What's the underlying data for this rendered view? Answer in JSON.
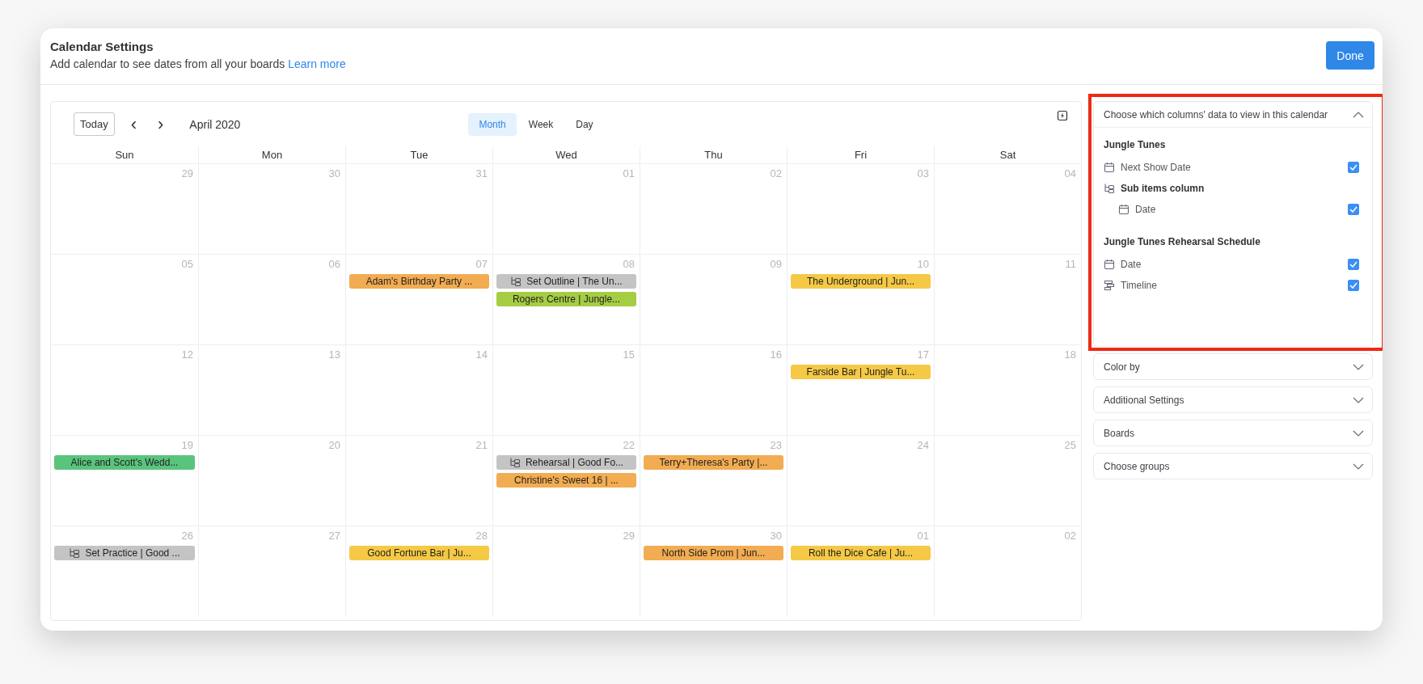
{
  "header": {
    "title": "Calendar Settings",
    "subtitle": "Add calendar to see dates from all your boards",
    "link": "Learn more",
    "done_button": "Done"
  },
  "calendar": {
    "today_button": "Today",
    "prev": "‹",
    "next": "›",
    "month_label": "April 2020",
    "views": [
      {
        "label": "Month",
        "selected": true
      },
      {
        "label": "Week",
        "selected": false
      },
      {
        "label": "Day",
        "selected": false
      }
    ],
    "weekdays": [
      "Sun",
      "Mon",
      "Tue",
      "Wed",
      "Thu",
      "Fri",
      "Sat"
    ],
    "weeks": [
      [
        {
          "day": "29"
        },
        {
          "day": "30"
        },
        {
          "day": "31"
        },
        {
          "day": "01"
        },
        {
          "day": "02"
        },
        {
          "day": "03"
        },
        {
          "day": "04"
        }
      ],
      [
        {
          "day": "05"
        },
        {
          "day": "06"
        },
        {
          "day": "07",
          "events": [
            {
              "title": "Adam's Birthday Party ...",
              "color": "#f2ac52",
              "subitem": false
            }
          ]
        },
        {
          "day": "08",
          "events": [
            {
              "title": "Set Outline | The Un...",
              "color": "#c4c4c4",
              "subitem": true
            },
            {
              "title": "Rogers Centre | Jungle...",
              "color": "#a5cd44",
              "subitem": false
            }
          ]
        },
        {
          "day": "09"
        },
        {
          "day": "10",
          "events": [
            {
              "title": "The Underground | Jun...",
              "color": "#f5c945",
              "subitem": false
            }
          ]
        },
        {
          "day": "11"
        }
      ],
      [
        {
          "day": "12"
        },
        {
          "day": "13"
        },
        {
          "day": "14"
        },
        {
          "day": "15"
        },
        {
          "day": "16"
        },
        {
          "day": "17",
          "events": [
            {
              "title": "Farside Bar | Jungle Tu...",
              "color": "#f5c945",
              "subitem": false
            }
          ]
        },
        {
          "day": "18"
        }
      ],
      [
        {
          "day": "19",
          "events": [
            {
              "title": "Alice and Scott's Wedd...",
              "color": "#5ac47d",
              "subitem": false
            }
          ]
        },
        {
          "day": "20"
        },
        {
          "day": "21"
        },
        {
          "day": "22",
          "events": [
            {
              "title": "Rehearsal | Good Fo...",
              "color": "#c4c4c4",
              "subitem": true
            },
            {
              "title": "Christine's Sweet 16 | ...",
              "color": "#f2ac52",
              "subitem": false
            }
          ]
        },
        {
          "day": "23",
          "events": [
            {
              "title": "Terry+Theresa's Party |...",
              "color": "#f2ac52",
              "subitem": false
            }
          ]
        },
        {
          "day": "24"
        },
        {
          "day": "25"
        }
      ],
      [
        {
          "day": "26",
          "events": [
            {
              "title": "Set Practice | Good ...",
              "color": "#c4c4c4",
              "subitem": true
            }
          ]
        },
        {
          "day": "27"
        },
        {
          "day": "28",
          "events": [
            {
              "title": "Good Fortune Bar | Ju...",
              "color": "#f5c945",
              "subitem": false
            }
          ]
        },
        {
          "day": "29"
        },
        {
          "day": "30",
          "events": [
            {
              "title": "North Side Prom | Jun...",
              "color": "#f2ac52",
              "subitem": false
            }
          ]
        },
        {
          "day": "01",
          "events": [
            {
              "title": "Roll the Dice Cafe | Ju...",
              "color": "#f5c945",
              "subitem": false
            }
          ]
        },
        {
          "day": "02"
        }
      ]
    ]
  },
  "settings": {
    "sections": [
      {
        "title": "Choose which columns' data to view in this calendar",
        "expanded": true,
        "highlighted": true,
        "boards": [
          {
            "name": "Jungle Tunes",
            "rows": [
              {
                "kind": "date",
                "label": "Next Show Date",
                "checked": true
              },
              {
                "kind": "subitems",
                "label": "Sub items column",
                "children": [
                  {
                    "kind": "date",
                    "label": "Date",
                    "checked": true
                  }
                ]
              }
            ]
          },
          {
            "name": "Jungle Tunes Rehearsal Schedule",
            "rows": [
              {
                "kind": "date",
                "label": "Date",
                "checked": true
              },
              {
                "kind": "timeline",
                "label": "Timeline",
                "checked": true
              }
            ]
          }
        ]
      },
      {
        "title": "Color by",
        "expanded": false,
        "highlighted": false
      },
      {
        "title": "Additional Settings",
        "expanded": false,
        "highlighted": false
      },
      {
        "title": "Boards",
        "expanded": false,
        "highlighted": false
      },
      {
        "title": "Choose groups",
        "expanded": false,
        "highlighted": false
      }
    ]
  }
}
